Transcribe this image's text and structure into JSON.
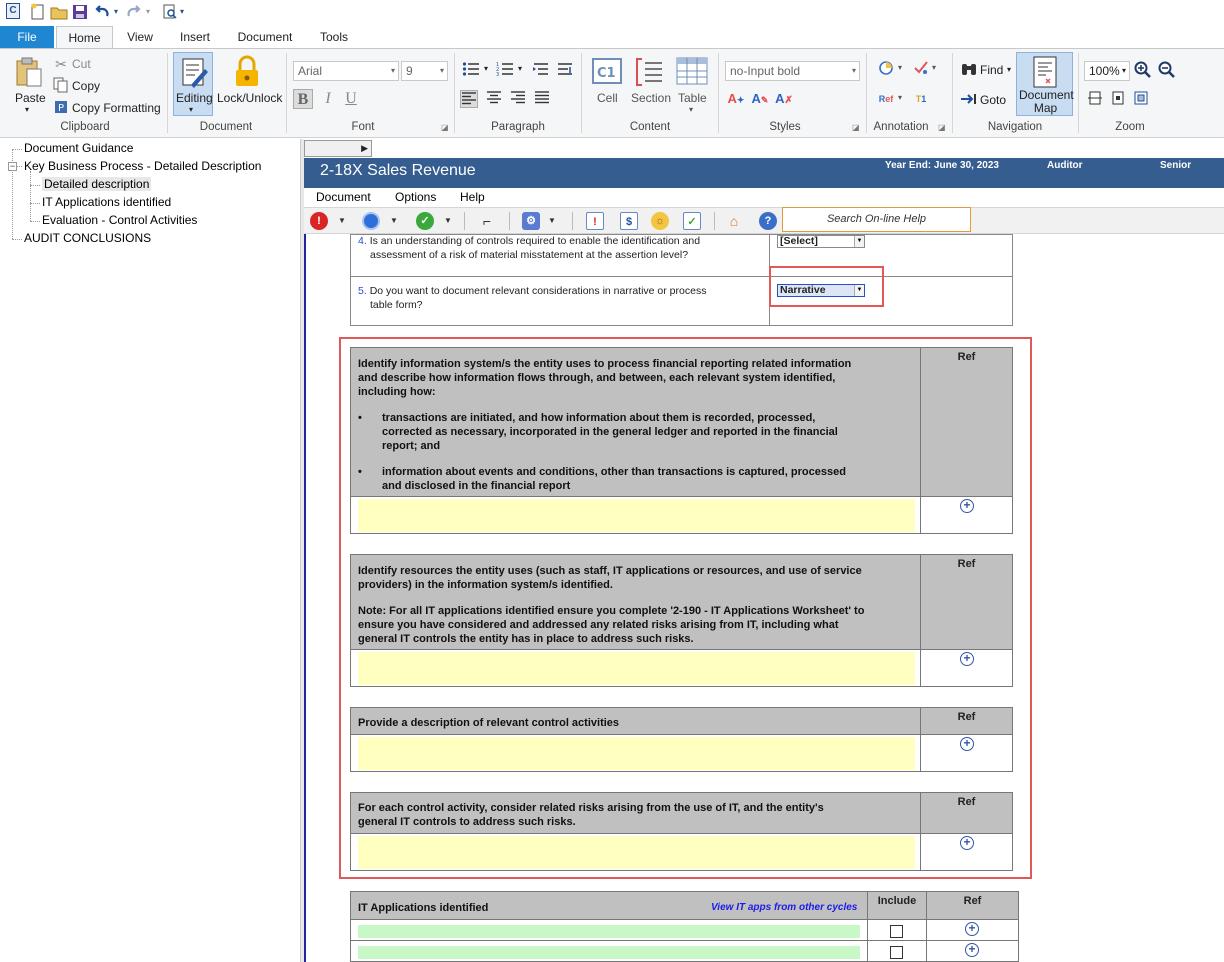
{
  "qat": {
    "undo_arrow": "▾",
    "redo_arrow": "▾",
    "more_arrow": "▾"
  },
  "tabs": {
    "file": "File",
    "home": "Home",
    "view": "View",
    "insert": "Insert",
    "document": "Document",
    "tools": "Tools"
  },
  "ribbon": {
    "clipboard": {
      "paste": "Paste",
      "cut": "Cut",
      "copy": "Copy",
      "copy_formatting": "Copy Formatting",
      "label": "Clipboard"
    },
    "document": {
      "editing": "Editing",
      "lock": "Lock/Unlock",
      "label": "Document"
    },
    "font": {
      "family": "Arial",
      "size": "9",
      "bold": "B",
      "italic": "I",
      "underline": "U",
      "label": "Font"
    },
    "paragraph": {
      "label": "Paragraph"
    },
    "content": {
      "cell": "Cell",
      "section": "Section",
      "table": "Table",
      "cell_icon_text": "C1",
      "label": "Content"
    },
    "styles": {
      "style": "no-Input bold",
      "label": "Styles"
    },
    "annotation": {
      "label": "Annotation"
    },
    "navigation": {
      "find": "Find",
      "goto": "Goto",
      "doc_map_line1": "Document",
      "doc_map_line2": "Map",
      "label": "Navigation"
    },
    "zoom": {
      "level": "100%",
      "label": "Zoom"
    }
  },
  "tree": {
    "items": [
      {
        "label": "Document Guidance"
      },
      {
        "label": "Key Business Process - Detailed Description"
      },
      {
        "label": "Detailed description"
      },
      {
        "label": "IT Applications identified"
      },
      {
        "label": "Evaluation - Control Activities"
      },
      {
        "label": "AUDIT CONCLUSIONS"
      }
    ],
    "collapse_glyph": "−"
  },
  "doc": {
    "title": "2-18X Sales Revenue",
    "year_end": "Year End: June 30, 2023",
    "auditor": "Auditor",
    "senior": "Senior",
    "menu": [
      "Document",
      "Options",
      "Help"
    ],
    "search_help": "Search On-line Help"
  },
  "questions": [
    {
      "num": "4.",
      "line1": "Is an understanding of controls required to enable the identification and",
      "line2": "assessment of a risk of material misstatement at the assertion level?",
      "value": "[Select]"
    },
    {
      "num": "5.",
      "line1": "Do you want to document relevant considerations in narrative or process",
      "line2": "table form?",
      "value": "Narrative"
    }
  ],
  "sections": {
    "ref_label": "Ref",
    "s1": {
      "intro1": "Identify information system/s the entity uses to process financial reporting related information",
      "intro2": "and describe how information flows through, and between, each relevant system identified,",
      "intro3": "including how:",
      "b1_line1": "transactions are initiated, and how information about them is recorded, processed,",
      "b1_line2": "corrected as necessary, incorporated in the general ledger and reported in the financial",
      "b1_line3": "report; and",
      "b2_line1": "information about events and conditions, other than transactions is captured, processed",
      "b2_line2": "and disclosed in the financial report",
      "bullet": "•"
    },
    "s2": {
      "line1": "Identify resources the entity uses (such as staff, IT applications or resources, and use of service",
      "line2": "providers) in the information system/s identified.",
      "note1": "Note: For all IT applications identified ensure you complete '2-190 - IT Applications Worksheet' to",
      "note2": "ensure you have considered and addressed any related risks arising from IT, including what",
      "note3": "general IT controls the entity has in place to address such risks."
    },
    "s3": {
      "line1": "Provide a description of relevant control activities"
    },
    "s4": {
      "line1": "For each control activity, consider related risks arising from the use of IT, and the entity's",
      "line2": "general IT controls to address such risks."
    },
    "it": {
      "title": "IT Applications identified",
      "link": "View IT apps from other cycles",
      "include": "Include"
    }
  }
}
